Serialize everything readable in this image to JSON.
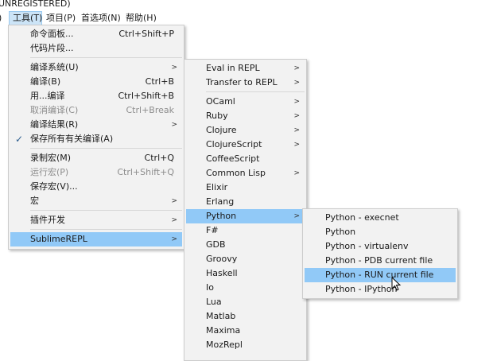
{
  "window": {
    "title": "UNREGISTERED)"
  },
  "menubar": {
    "edge": ")",
    "items": [
      {
        "label": "工具(T)"
      },
      {
        "label": "项目(P)"
      },
      {
        "label": "首选项(N)"
      },
      {
        "label": "帮助(H)"
      }
    ]
  },
  "tools_menu": {
    "items": [
      {
        "label": "命令面板...",
        "shortcut": "Ctrl+Shift+P"
      },
      {
        "label": "代码片段..."
      },
      {
        "label": "编译系统(U)"
      },
      {
        "label": "编译(B)",
        "shortcut": "Ctrl+B"
      },
      {
        "label": "用...编译",
        "shortcut": "Ctrl+Shift+B"
      },
      {
        "label": "取消编译(C)",
        "shortcut": "Ctrl+Break"
      },
      {
        "label": "编译结果(R)"
      },
      {
        "label": "保存所有有关编译(A)",
        "check": "✓"
      },
      {
        "label": "录制宏(M)",
        "shortcut": "Ctrl+Q"
      },
      {
        "label": "运行宏(P)",
        "shortcut": "Ctrl+Shift+Q"
      },
      {
        "label": "保存宏(V)..."
      },
      {
        "label": "宏"
      },
      {
        "label": "插件开发"
      },
      {
        "label": "SublimeREPL"
      }
    ]
  },
  "repl_menu": {
    "items": [
      {
        "label": "Eval in REPL"
      },
      {
        "label": "Transfer to REPL"
      },
      {
        "label": "OCaml"
      },
      {
        "label": "Ruby"
      },
      {
        "label": "Clojure"
      },
      {
        "label": "ClojureScript"
      },
      {
        "label": "CoffeeScript"
      },
      {
        "label": "Common Lisp"
      },
      {
        "label": "Elixir"
      },
      {
        "label": "Erlang"
      },
      {
        "label": "Python"
      },
      {
        "label": "F#"
      },
      {
        "label": "GDB"
      },
      {
        "label": "Groovy"
      },
      {
        "label": "Haskell"
      },
      {
        "label": "Io"
      },
      {
        "label": "Lua"
      },
      {
        "label": "Matlab"
      },
      {
        "label": "Maxima"
      },
      {
        "label": "MozRepl"
      }
    ]
  },
  "python_menu": {
    "items": [
      {
        "label": "Python - execnet"
      },
      {
        "label": "Python"
      },
      {
        "label": "Python - virtualenv"
      },
      {
        "label": "Python - PDB current file"
      },
      {
        "label": "Python - RUN current file"
      },
      {
        "label": "Python - IPython"
      }
    ]
  },
  "icons": {
    "arrow": "submenu-arrow-icon",
    "check": "checkmark-icon",
    "cursor": "mouse-pointer-icon"
  }
}
